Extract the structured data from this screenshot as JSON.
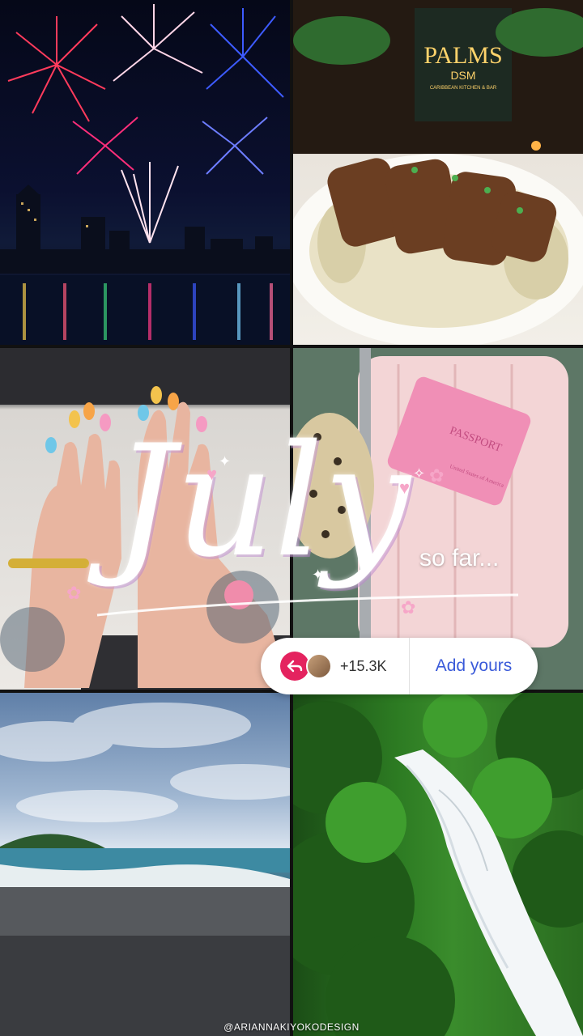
{
  "story": {
    "title_main": "July",
    "title_sub": "so far...",
    "credit": "@ARIANNAKIYOKODESIGN"
  },
  "sticker": {
    "count": "+15.3K",
    "add_label": "Add yours",
    "reply_icon": "reply-arrow-icon"
  },
  "photos": {
    "top_right_sign_line1": "PALMS",
    "top_right_sign_line2": "DSM",
    "top_right_sign_line3": "CARIBBEAN KITCHEN & BAR",
    "passport_label": "PASSPORT",
    "passport_sub": "United States of America"
  },
  "colors": {
    "accent_pink": "#e4235f",
    "add_yours_blue": "#3a5ad9"
  }
}
